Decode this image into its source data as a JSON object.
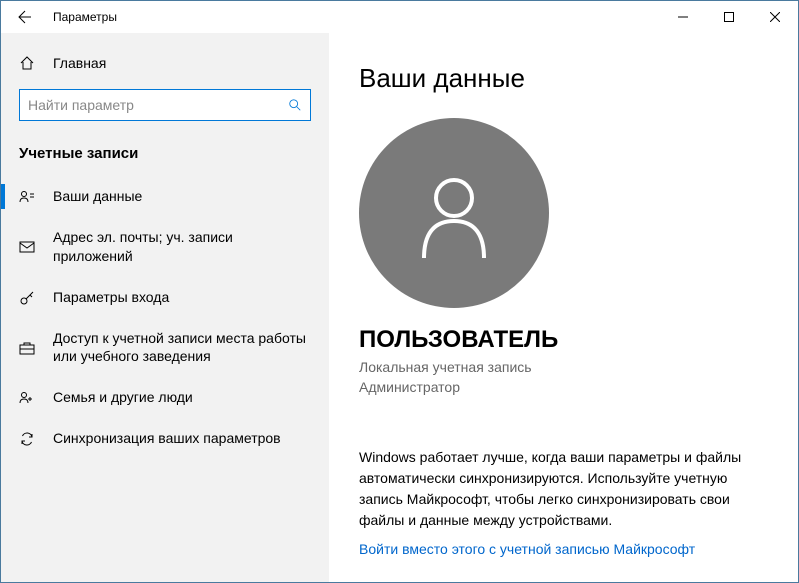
{
  "window": {
    "title": "Параметры"
  },
  "sidebar": {
    "home": "Главная",
    "search": {
      "placeholder": "Найти параметр"
    },
    "section": "Учетные записи",
    "items": [
      {
        "label": "Ваши данные"
      },
      {
        "label": "Адрес эл. почты; уч. записи приложений"
      },
      {
        "label": "Параметры входа"
      },
      {
        "label": "Доступ к учетной записи места работы или учебного заведения"
      },
      {
        "label": "Семья и другие люди"
      },
      {
        "label": "Синхронизация ваших параметров"
      }
    ]
  },
  "main": {
    "title": "Ваши данные",
    "username": "ПОЛЬЗОВАТЕЛЬ",
    "acct_type": "Локальная учетная запись",
    "acct_role": "Администратор",
    "sync_text": "Windows работает лучше, когда ваши параметры и файлы автоматически синхронизируются. Используйте учетную запись Майкрософт, чтобы легко синхронизировать свои файлы и данные между устройствами.",
    "link": "Войти вместо этого с учетной записью Майкрософт"
  }
}
